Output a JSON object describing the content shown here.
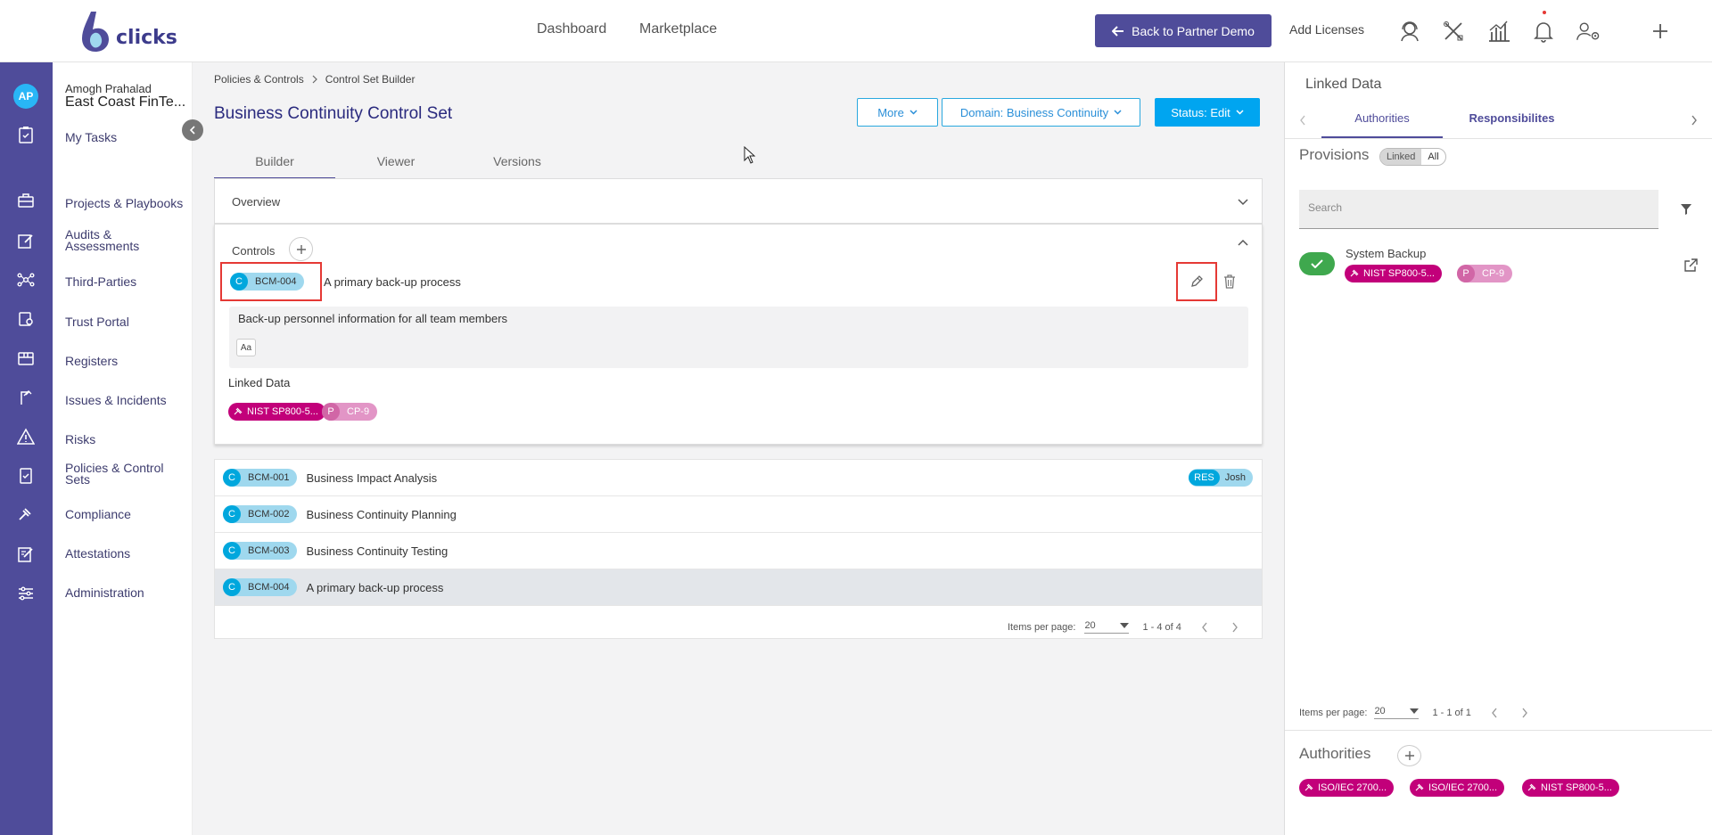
{
  "topbar": {
    "logo_text": "clicks",
    "nav": [
      "Dashboard",
      "Marketplace"
    ],
    "back_button": "Back to Partner Demo",
    "add_licenses": "Add Licenses"
  },
  "user": {
    "initials": "AP",
    "name": "Amogh Prahalad",
    "org": "East Coast FinTe..."
  },
  "sidebar": {
    "my_tasks": "My Tasks",
    "items": [
      "Projects & Playbooks",
      "Audits & Assessments",
      "Third-Parties",
      "Trust Portal",
      "Registers",
      "Issues & Incidents",
      "Risks",
      "Policies & Control Sets",
      "Compliance",
      "Attestations",
      "Administration"
    ]
  },
  "breadcrumb": [
    "Policies & Controls",
    "Control Set Builder"
  ],
  "page_title": "Business Continuity Control Set",
  "header_buttons": {
    "more": "More",
    "domain": "Domain: Business Continuity",
    "status": "Status: Edit"
  },
  "tabs": [
    "Builder",
    "Viewer",
    "Versions"
  ],
  "overview_label": "Overview",
  "controls_label": "Controls",
  "control_detail": {
    "type": "C",
    "id": "BCM-004",
    "title": "A primary back-up process",
    "description": "Back-up personnel information for all team members",
    "text_format_label": "Aa",
    "linked_data_label": "Linked Data",
    "linked": [
      {
        "kind": "authority",
        "label": "NIST SP800-5..."
      },
      {
        "kind": "provision",
        "letter": "P",
        "label": "CP-9"
      }
    ]
  },
  "controls_table": {
    "rows": [
      {
        "type": "C",
        "id": "BCM-001",
        "title": "Business Impact Analysis",
        "badge": {
          "tag": "RES",
          "name": "Josh"
        }
      },
      {
        "type": "C",
        "id": "BCM-002",
        "title": "Business Continuity Planning"
      },
      {
        "type": "C",
        "id": "BCM-003",
        "title": "Business Continuity Testing"
      },
      {
        "type": "C",
        "id": "BCM-004",
        "title": "A primary back-up process",
        "selected": true
      }
    ],
    "pager": {
      "label": "Items per page:",
      "per_page": "20",
      "range": "1 - 4 of 4"
    }
  },
  "right_panel": {
    "title": "Linked Data",
    "tabs": [
      "Authorities",
      "Responsibilites"
    ],
    "provisions_label": "Provisions",
    "toggle": [
      "Linked",
      "All"
    ],
    "search_placeholder": "Search",
    "items": [
      {
        "title": "System Backup",
        "authority": "NIST SP800-5...",
        "provision_letter": "P",
        "provision": "CP-9"
      }
    ],
    "pager": {
      "label": "Items per page:",
      "per_page": "20",
      "range": "1 - 1 of 1"
    },
    "authorities_label": "Authorities",
    "authorities": [
      "ISO/IEC 2700...",
      "ISO/IEC 2700...",
      "NIST SP800-5..."
    ]
  },
  "colors": {
    "brand": "#4f4c9a",
    "accent": "#00a5f0",
    "authority_chip": "#c2007a",
    "control_chip": "#9fd8ee",
    "highlight": "#e53935"
  }
}
